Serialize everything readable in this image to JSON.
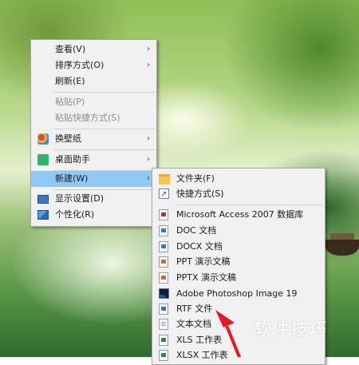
{
  "context_menu": {
    "items": [
      {
        "label": "查看(V)",
        "has_submenu": true
      },
      {
        "label": "排序方式(O)",
        "has_submenu": true
      },
      {
        "label": "刷新(E)"
      },
      {
        "label": "粘贴(P)",
        "disabled": true
      },
      {
        "label": "粘贴快捷方式(S)",
        "disabled": true
      },
      {
        "label": "换壁纸",
        "has_submenu": true,
        "icon": "wallpaper-icon"
      },
      {
        "label": "桌面助手",
        "has_submenu": true,
        "icon": "desktop-assistant-icon"
      },
      {
        "label": "新建(W)",
        "has_submenu": true,
        "selected": true
      },
      {
        "label": "显示设置(D)",
        "icon": "display-settings-icon"
      },
      {
        "label": "个性化(R)",
        "icon": "personalize-icon"
      }
    ],
    "arrow_glyph": "›"
  },
  "new_submenu": {
    "items": [
      {
        "label": "文件夹(F)",
        "icon": "folder-icon"
      },
      {
        "label": "快捷方式(S)",
        "icon": "shortcut-icon"
      },
      {
        "label": "Microsoft Access 2007 数据库",
        "icon": "access-icon"
      },
      {
        "label": "DOC 文档",
        "icon": "doc-icon"
      },
      {
        "label": "DOCX 文档",
        "icon": "docx-icon"
      },
      {
        "label": "PPT 演示文稿",
        "icon": "ppt-icon"
      },
      {
        "label": "PPTX 演示文稿",
        "icon": "pptx-icon"
      },
      {
        "label": "Adobe Photoshop Image 19",
        "icon": "photoshop-icon"
      },
      {
        "label": "RTF 文件",
        "icon": "rtf-icon"
      },
      {
        "label": "文本文档",
        "icon": "text-document-icon"
      },
      {
        "label": "XLS 工作表",
        "icon": "xls-icon"
      },
      {
        "label": "XLSX 工作表",
        "icon": "xlsx-icon"
      }
    ]
  },
  "watermark": "软件技巧",
  "colors": {
    "menu_bg": "#f1f1f1",
    "highlight": "#90c8f6",
    "arrow": "#e8191c"
  }
}
